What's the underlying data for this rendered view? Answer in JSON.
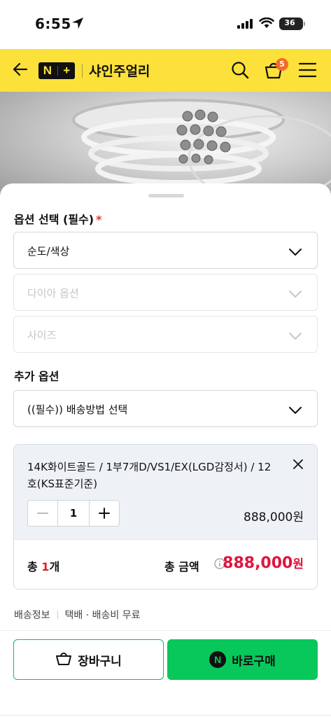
{
  "status_bar": {
    "time": "6:55",
    "battery": "36"
  },
  "header": {
    "logo_left": "N",
    "logo_right": "+",
    "store_name": "샤인주얼리",
    "cart_count": "5"
  },
  "options": {
    "title": "옵션 선택 (필수)",
    "required_mark": "*",
    "selects": [
      {
        "label": "순도/색상",
        "enabled": true
      },
      {
        "label": "다이아 옵션",
        "enabled": false
      },
      {
        "label": "사이즈",
        "enabled": false
      }
    ]
  },
  "additional": {
    "title": "추가 옵션",
    "select_label": "((필수)) 배송방법 선택"
  },
  "selected_item": {
    "name": "14K화이트골드 / 1부7개D/VS1/EX(LGD감정서) / 12호(KS표준기준)",
    "quantity": "1",
    "price": "888,000원"
  },
  "total": {
    "count_prefix": "총 ",
    "count_num": "1",
    "count_suffix": "개",
    "label": "총 금액",
    "amount": "888,000",
    "currency": "원"
  },
  "delivery": {
    "label": "배송정보",
    "value": "택배 · 배송비 무료"
  },
  "buttons": {
    "cart": "장바구니",
    "buy": "바로구매",
    "buy_badge": "N"
  }
}
